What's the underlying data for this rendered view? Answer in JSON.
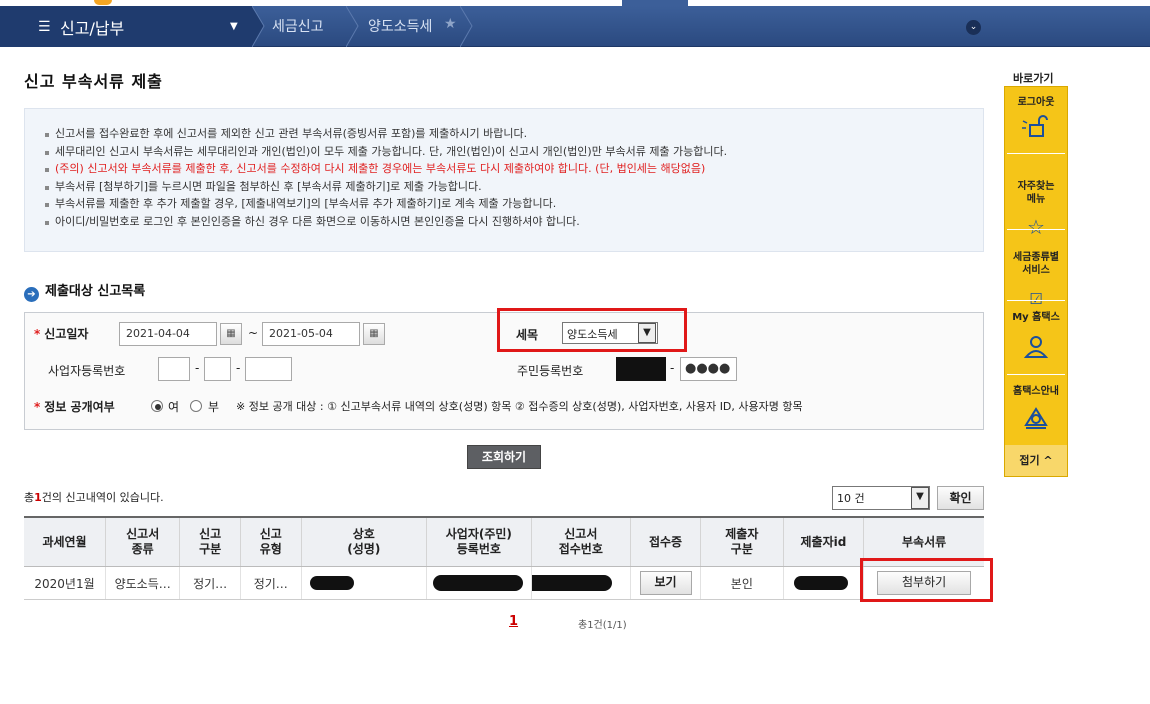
{
  "nav": {
    "menu_label": "신고/납부",
    "breadcrumb": [
      "세금신고",
      "양도소득세"
    ]
  },
  "page": {
    "title": "신고 부속서류 제출"
  },
  "notices": [
    {
      "text": "신고서를 접수완료한 후에 신고서를 제외한 신고 관련 부속서류(증빙서류 포함)를 제출하시기 바랍니다.",
      "red": false
    },
    {
      "text": "세무대리인 신고시 부속서류는 세무대리인과 개인(법인)이 모두 제출 가능합니다. 단, 개인(법인)이 신고시 개인(법인)만 부속서류 제출 가능합니다.",
      "red": false
    },
    {
      "text": "(주의) 신고서와 부속서류를 제출한 후, 신고서를 수정하여 다시 제출한 경우에는 부속서류도 다시 제출하여야 합니다. (단, 법인세는 해당없음)",
      "red": true
    },
    {
      "text": "부속서류 [첨부하기]를 누르시면 파일을 첨부하신 후 [부속서류 제출하기]로 제출 가능합니다.",
      "red": false
    },
    {
      "text": "부속서류를 제출한 후 추가 제출할 경우, [제출내역보기]의 [부속서류 추가 제출하기]로 계속 제출 가능합니다.",
      "red": false
    },
    {
      "text": "아이디/비밀번호로 로그인 후 본인인증을 하신 경우 다른 화면으로 이동하시면 본인인증을 다시 진행하셔야 합니다.",
      "red": false
    }
  ],
  "section_title": "제출대상 신고목록",
  "form": {
    "date_label": "신고일자",
    "date_from": "2021-04-04",
    "tilde": "~",
    "date_to": "2021-05-04",
    "tax_item_label": "세목",
    "tax_item_value": "양도소득세",
    "biz_no_label": "사업자등록번호",
    "dash": "-",
    "resident_no_label": "주민등록번호",
    "resident_no_tail": "●●●●",
    "disclosure_label": "정보 공개여부",
    "radio_yes": "여",
    "radio_no": "부",
    "disclosure_note": "※ 정보 공개 대상 : ① 신고부속서류 내역의 상호(성명) 항목 ② 접수증의 상호(성명), 사업자번호, 사용자 ID, 사용자명 항목"
  },
  "search_button": "조회하기",
  "result": {
    "count_prefix": "총",
    "count": "1",
    "count_suffix": "건의 신고내역이 있습니다.",
    "page_size": "10 건",
    "confirm_button": "확인"
  },
  "table": {
    "headers": [
      [
        "과세연월"
      ],
      [
        "신고서",
        "종류"
      ],
      [
        "신고",
        "구분"
      ],
      [
        "신고",
        "유형"
      ],
      [
        "상호",
        "(성명)"
      ],
      [
        "사업자(주민)",
        "등록번호"
      ],
      [
        "신고서",
        "접수번호"
      ],
      [
        "접수증"
      ],
      [
        "제출자",
        "구분"
      ],
      [
        "제출자id"
      ],
      [
        "부속서류"
      ]
    ],
    "row": {
      "period": "2020년1월",
      "form_type": "양도소득…",
      "report_div": "정기…",
      "report_type": "정기…",
      "view_button": "보기",
      "submitter": "본인",
      "attach_button": "첨부하기"
    }
  },
  "pager": {
    "current": "1",
    "info": "총1건(1/1)"
  },
  "quick": {
    "title": "바로가기",
    "items": [
      "로그아웃",
      "자주찾는\n메뉴",
      "세금종류별\n서비스",
      "My 홈택스",
      "홈택스안내"
    ],
    "close": "접기 ^"
  }
}
